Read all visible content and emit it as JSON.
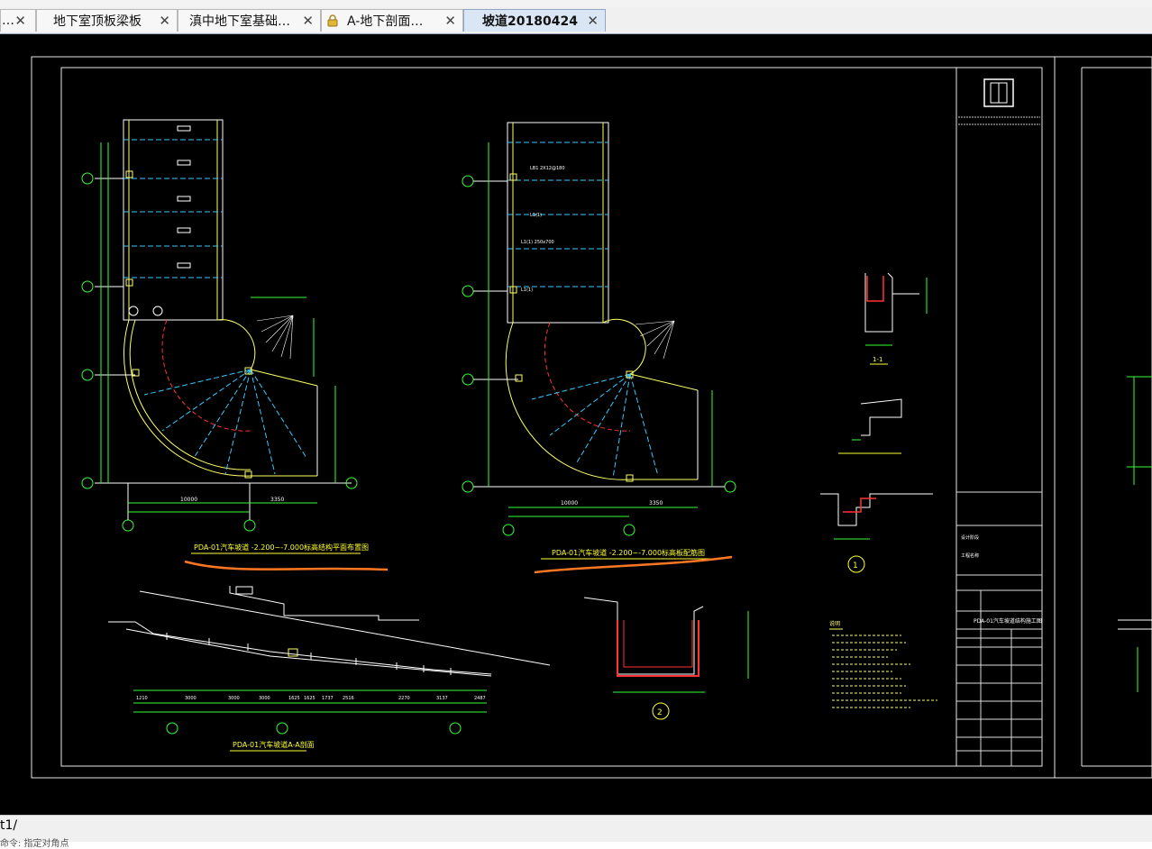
{
  "tabs": [
    {
      "label": "…",
      "close": "✕"
    },
    {
      "label": "地下室顶板梁板",
      "close": "✕"
    },
    {
      "label": "滇中地下室基础…",
      "close": "✕"
    },
    {
      "label": "A-地下剖面…",
      "close": "✕",
      "locked": true
    },
    {
      "label": "坡道20180424",
      "close": "✕",
      "active": true
    }
  ],
  "drawing": {
    "plan_left_title": "PDA-01汽车坡道 -2.200~-7.000标高结构平面布置图",
    "plan_right_title": "PDA-01汽车坡道 -2.200~-7.000标高板配筋图",
    "section_title": "PDA-01汽车坡道A-A剖面",
    "section_11": "1-1",
    "detail_1": "1",
    "detail_2": "2",
    "notes_heading": "说明",
    "project_title": "PDA-01汽车坡道结构施工图",
    "dims_left": [
      "10000",
      "3350"
    ],
    "dims_right": [
      "10000",
      "3350"
    ],
    "section_dims": [
      "1210",
      "3000",
      "3000",
      "3000",
      "1625",
      "1625",
      "1737",
      "2516",
      "2270",
      "3137",
      "2487"
    ]
  },
  "bottom": {
    "layout_tab": "t1/",
    "status": "命令: 指定对角点"
  }
}
